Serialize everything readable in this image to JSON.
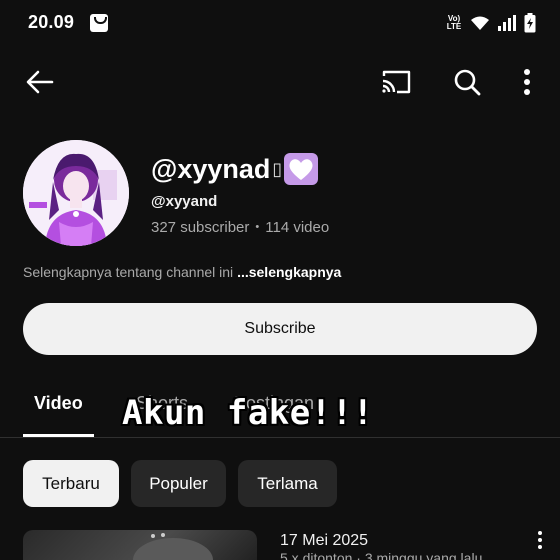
{
  "status_bar": {
    "time": "20.09",
    "volte_label": "Vo))\nLTE",
    "icons": [
      "shopping-bag-icon",
      "volte-icon",
      "wifi-icon",
      "signal-icon",
      "battery-charging-icon"
    ]
  },
  "top_nav": {
    "icons": [
      "back-arrow-icon",
      "cast-icon",
      "search-icon",
      "more-vert-icon"
    ]
  },
  "channel": {
    "name": "@xyynad",
    "name_emoji": "purple-heart-icon",
    "handle": "@xyyand",
    "subscribers": "327 subscriber",
    "videos": "114 video",
    "stats_separator": "•",
    "description": "Selengkapnya tentang channel ini ",
    "description_more": "...selengkapnya"
  },
  "subscribe_label": "Subscribe",
  "tabs": [
    {
      "label": "Video",
      "active": true
    },
    {
      "label": "Shorts",
      "active": false
    },
    {
      "label": "Postingan",
      "active": false
    }
  ],
  "overlay_text": "Akun fake!!!",
  "filter_chips": [
    {
      "label": "Terbaru",
      "selected": true
    },
    {
      "label": "Populer",
      "selected": false
    },
    {
      "label": "Terlama",
      "selected": false
    }
  ],
  "videos": [
    {
      "date": "17 Mei 2025",
      "meta": "5 x ditonton · 3 minggu yang lalu"
    }
  ],
  "colors": {
    "background": "#0f0f0f",
    "text_secondary": "#aaaaaa",
    "chip_bg": "#272727",
    "subscribe_bg": "#f1f1f1",
    "avatar_accent": "#a23fd0"
  }
}
